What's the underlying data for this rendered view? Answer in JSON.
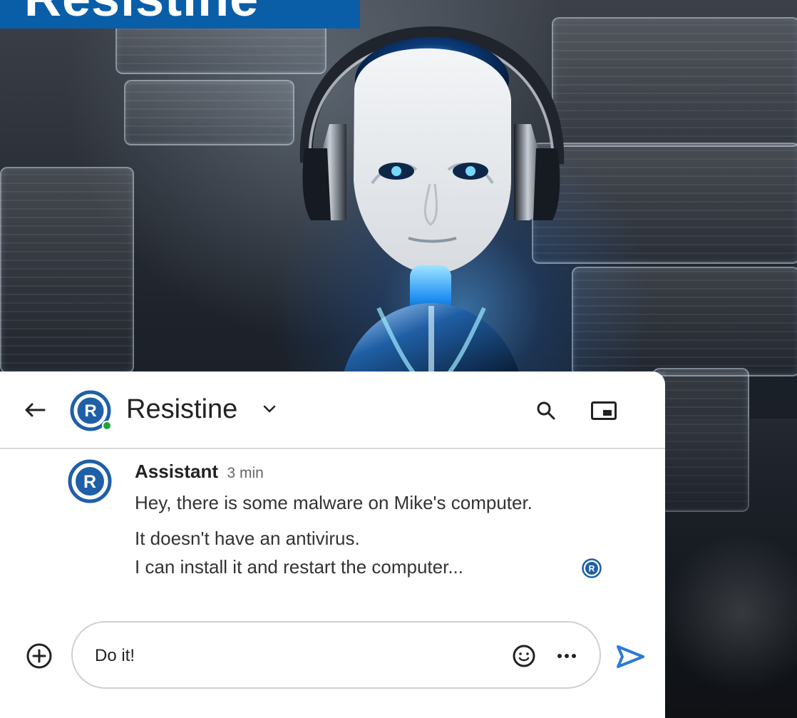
{
  "banner": {
    "text": "Resistine"
  },
  "header": {
    "back_icon": "arrow-left-icon",
    "avatar_icon": "r-logo-icon",
    "title": "Resistine",
    "title_chevron_icon": "chevron-down-icon",
    "search_icon": "search-icon",
    "pip_icon": "picture-in-picture-icon"
  },
  "message": {
    "author": "Assistant",
    "time": "3 min",
    "lines": [
      "Hey, there is some malware on Mike's computer.",
      "It doesn't have an antivirus.",
      "I can install it and restart the computer..."
    ],
    "receipt_icon": "r-logo-icon"
  },
  "composer": {
    "add_icon": "plus-circle-icon",
    "value": "Do it!",
    "emoji_icon": "emoji-icon",
    "more_icon": "more-horizontal-icon",
    "send_icon": "send-icon"
  },
  "colors": {
    "brand_blue": "#0a5ea8",
    "online_green": "#21a339",
    "send_blue": "#2d79d8"
  }
}
